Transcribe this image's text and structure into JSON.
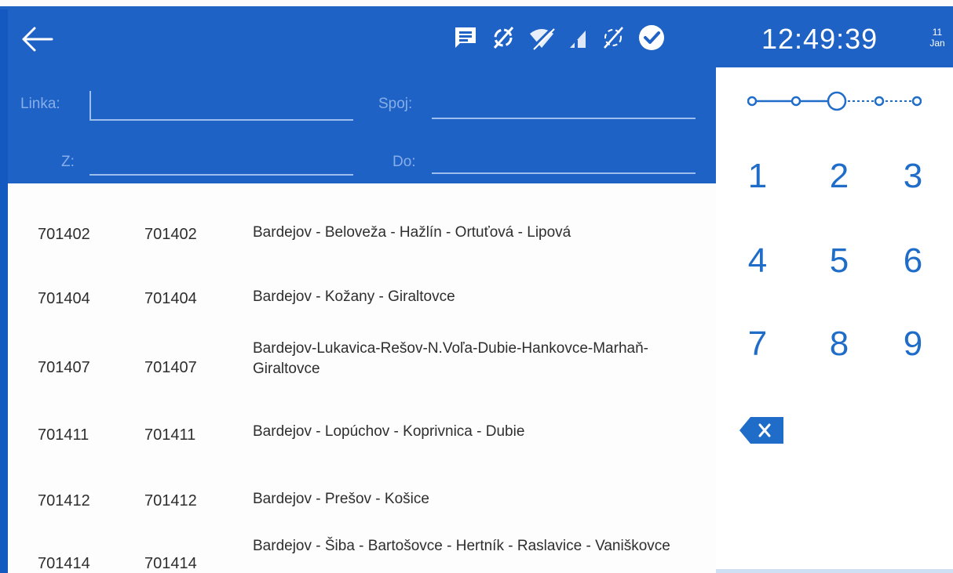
{
  "status_bar": {
    "time": "12:49:39",
    "date_day": "11",
    "date_month": "Jan",
    "icons": [
      "message-icon",
      "sync-off-icon",
      "wifi-off-icon",
      "signal-icon",
      "sync-disabled-icon",
      "check-circle-icon"
    ]
  },
  "filters": {
    "linka_label": "Linka:",
    "linka_value": "",
    "spoj_label": "Spoj:",
    "spoj_value": "",
    "z_label": "Z:",
    "z_value": "",
    "do_label": "Do:",
    "do_value": ""
  },
  "routes": [
    {
      "code": "701402",
      "line": "701402",
      "name": "Bardejov - Beloveža - Hažlín - Ortuťová - Lipová"
    },
    {
      "code": "701404",
      "line": "701404",
      "name": "Bardejov - Kožany - Giraltovce"
    },
    {
      "code": "701407",
      "line": "701407",
      "name": "Bardejov-Lukavica-Rešov-N.Voľa-Dubie-Hankovce-Marhaň-Giraltovce"
    },
    {
      "code": "701411",
      "line": "701411",
      "name": "Bardejov - Lopúchov - Koprivnica - Dubie"
    },
    {
      "code": "701412",
      "line": "701412",
      "name": "Bardejov - Prešov - Košice"
    },
    {
      "code": "701414",
      "line": "701414",
      "name": "Bardejov - Šiba - Bartošovce - Hertník - Raslavice - Vaniškovce"
    }
  ],
  "keypad": {
    "keys": [
      "1",
      "2",
      "3",
      "4",
      "5",
      "6",
      "7",
      "8",
      "9"
    ],
    "backspace_icon": "backspace-icon",
    "step_current": 3,
    "step_total": 5
  },
  "colors": {
    "primary": "#1f62c6",
    "accent": "#1f6cc9",
    "label": "#86aee8"
  }
}
